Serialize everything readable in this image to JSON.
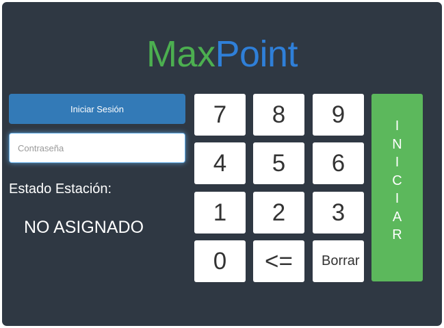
{
  "logo": {
    "part1": "Max",
    "part2": "Point",
    "colors": {
      "max": "#4caf50",
      "point": "#2f7fd8"
    }
  },
  "login": {
    "button_label": "Iniciar Sesión",
    "password_placeholder": "Contraseña",
    "password_value": ""
  },
  "status": {
    "label": "Estado Estación:",
    "value": "NO ASIGNADO"
  },
  "keypad": {
    "keys": [
      "7",
      "8",
      "9",
      "4",
      "5",
      "6",
      "1",
      "2",
      "3",
      "0",
      "<=",
      "Borrar"
    ]
  },
  "start_button": {
    "label": "INICIAR",
    "letters": [
      "I",
      "N",
      "I",
      "C",
      "I",
      "A",
      "R"
    ]
  },
  "colors": {
    "panel_bg": "#2f3843",
    "primary": "#337ab7",
    "success": "#5cb85c"
  }
}
